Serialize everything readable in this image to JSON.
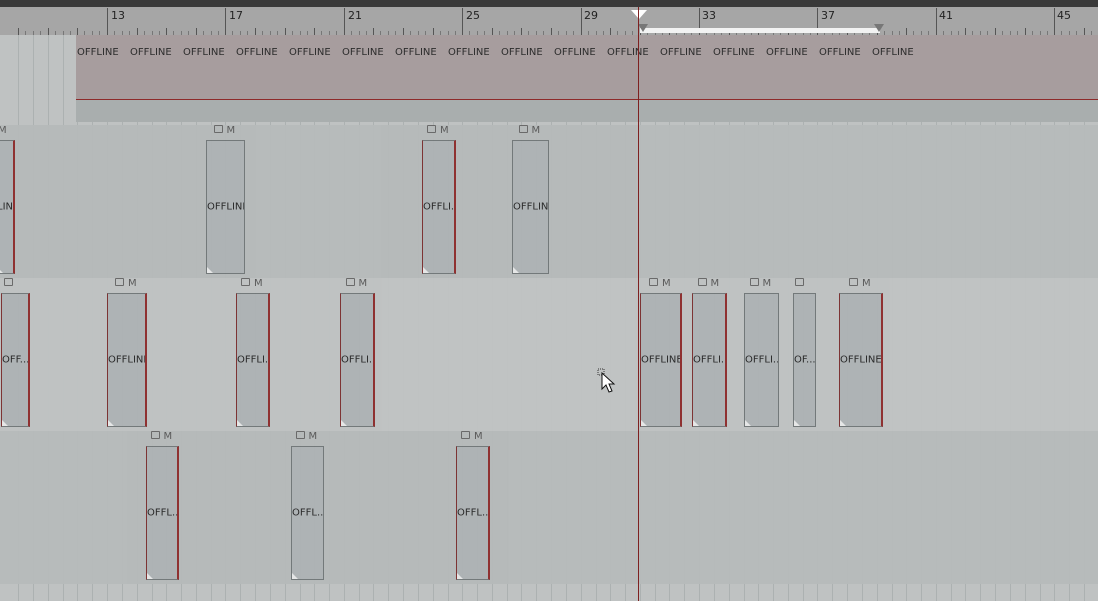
{
  "ruler": {
    "bars": [
      "13",
      "17",
      "21",
      "25",
      "29",
      "33",
      "37",
      "41",
      "45"
    ]
  },
  "offline_track": {
    "label": "OFFLINE",
    "count": 16
  },
  "lanes": [
    {
      "name": "lane-1",
      "clips": [
        {
          "label": "LINE",
          "icons": "M",
          "lock": false
        },
        {
          "label": "OFFLINE",
          "icons": "M",
          "lock": true
        },
        {
          "label": "OFFLI...",
          "icons": "M",
          "lock": true
        },
        {
          "label": "OFFLINE",
          "icons": "M",
          "lock": true
        }
      ]
    },
    {
      "name": "lane-2",
      "clips": [
        {
          "label": "OFF...",
          "icons": "",
          "lock": true
        },
        {
          "label": "OFFLINE",
          "icons": "M",
          "lock": true
        },
        {
          "label": "OFFLI...",
          "icons": "M",
          "lock": true
        },
        {
          "label": "OFFLI...",
          "icons": "M",
          "lock": true
        },
        {
          "label": "OFFLINE",
          "icons": "M",
          "lock": true
        },
        {
          "label": "OFFLI...",
          "icons": "M",
          "lock": true
        },
        {
          "label": "OFFLI...",
          "icons": "M",
          "lock": true
        },
        {
          "label": "OF...",
          "icons": "",
          "lock": true
        },
        {
          "label": "OFFLINE",
          "icons": "M",
          "lock": true
        }
      ]
    },
    {
      "name": "lane-3",
      "clips": [
        {
          "label": "OFFL...",
          "icons": "M",
          "lock": true
        },
        {
          "label": "OFFL...",
          "icons": "M",
          "lock": true
        },
        {
          "label": "OFFL...",
          "icons": "M",
          "lock": true
        }
      ]
    }
  ],
  "colors": {
    "playhead": "#7e2020",
    "offline_bg": "#a79d9e",
    "clip_bg": "#aeb3b5"
  }
}
